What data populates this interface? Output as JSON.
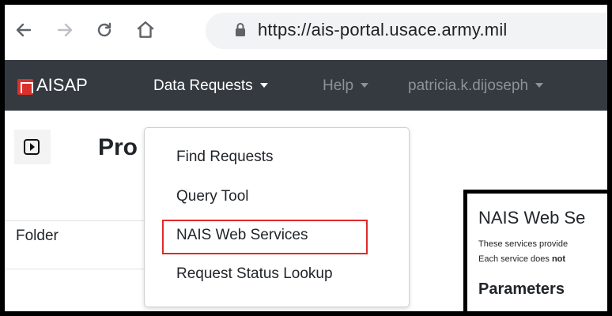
{
  "browser": {
    "url": "https://ais-portal.usace.army.mil"
  },
  "navbar": {
    "brand": "AISAP",
    "items": [
      {
        "label": "Data Requests"
      },
      {
        "label": "Help"
      },
      {
        "label": "patricia.k.dijoseph"
      }
    ]
  },
  "page": {
    "title": "Pro",
    "folder_label": "Folder"
  },
  "dropdown": {
    "items": [
      {
        "label": "Find Requests"
      },
      {
        "label": "Query Tool"
      },
      {
        "label": "NAIS Web Services"
      },
      {
        "label": "Request Status Lookup"
      }
    ]
  },
  "panel": {
    "title": "NAIS Web Se",
    "line1": "These services provide",
    "line2_prefix": "Each service does ",
    "line2_bold": "not",
    "subheading": "Parameters"
  },
  "colors": {
    "navbar_bg": "#343a40",
    "highlight": "#e12a2a",
    "brand_icon": "#d9302c"
  }
}
